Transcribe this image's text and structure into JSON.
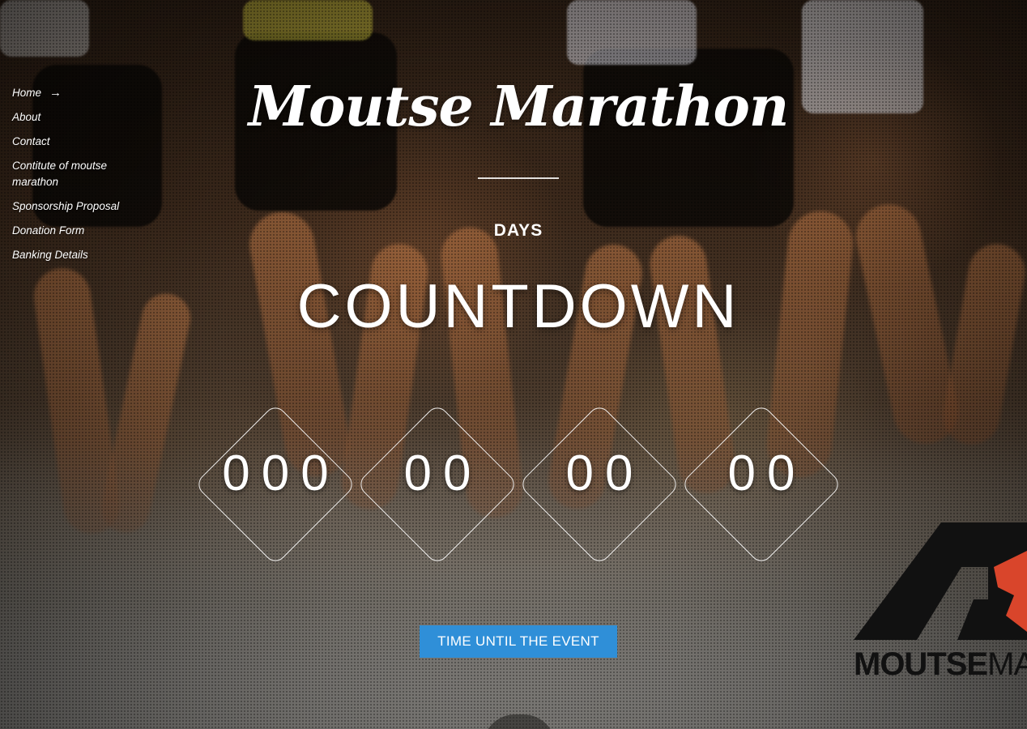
{
  "site": {
    "title": "Moutse Marathon"
  },
  "nav": {
    "items": [
      {
        "label": "Home",
        "arrow": "→"
      },
      {
        "label": "About"
      },
      {
        "label": "Contact"
      },
      {
        "label": "Contitute of moutse marathon"
      },
      {
        "label": "Sponsorship Proposal"
      },
      {
        "label": "Donation Form"
      },
      {
        "label": "Banking Details"
      }
    ]
  },
  "countdown": {
    "unit_label": "DAYS",
    "heading": "COUNTDOWN",
    "segments": [
      "000",
      "00",
      "00",
      "00"
    ],
    "cta_label": "TIME UNTIL THE EVENT"
  },
  "logo": {
    "text_bold": "MOUTSE",
    "text_thin": "MA"
  },
  "colors": {
    "cta_bg": "#2f8fd8",
    "text": "#ffffff",
    "logo_red": "#d9452b",
    "logo_dark": "#111111"
  }
}
